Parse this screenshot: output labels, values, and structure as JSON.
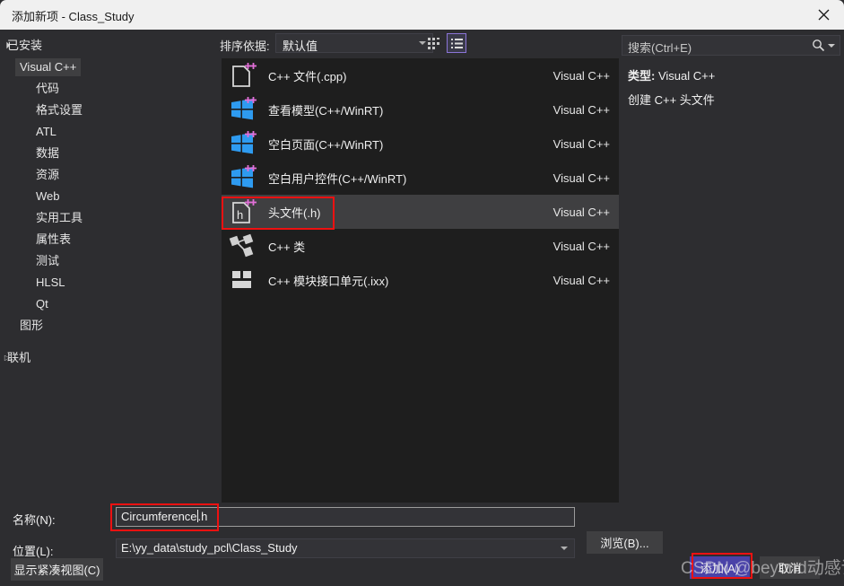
{
  "window": {
    "title": "添加新项 - Class_Study",
    "close_icon": "close-icon"
  },
  "sidebar": {
    "items": [
      {
        "label": "已安装",
        "level": 0,
        "arrow": "▲",
        "selected": false
      },
      {
        "label": "Visual C++",
        "level": 1,
        "arrow": "▲",
        "selected": true
      },
      {
        "label": "代码",
        "level": 2,
        "arrow": "",
        "selected": false
      },
      {
        "label": "格式设置",
        "level": 2,
        "arrow": "",
        "selected": false
      },
      {
        "label": "ATL",
        "level": 2,
        "arrow": "",
        "selected": false
      },
      {
        "label": "数据",
        "level": 2,
        "arrow": "",
        "selected": false
      },
      {
        "label": "资源",
        "level": 2,
        "arrow": "",
        "selected": false
      },
      {
        "label": "Web",
        "level": 2,
        "arrow": "",
        "selected": false
      },
      {
        "label": "实用工具",
        "level": 2,
        "arrow": "",
        "selected": false
      },
      {
        "label": "属性表",
        "level": 2,
        "arrow": "",
        "selected": false
      },
      {
        "label": "测试",
        "level": 2,
        "arrow": "",
        "selected": false
      },
      {
        "label": "HLSL",
        "level": 2,
        "arrow": "",
        "selected": false
      },
      {
        "label": "Qt",
        "level": 2,
        "arrow": "",
        "selected": false
      },
      {
        "label": "图形",
        "level": 1,
        "arrow": "",
        "selected": false
      },
      {
        "label": "联机",
        "level": 0,
        "arrow": "▶",
        "selected": false
      }
    ]
  },
  "toolbar": {
    "sort_label": "排序依据:",
    "sort_value": "默认值",
    "grid_view_icon": "grid-view-icon",
    "list_view_icon": "list-view-icon"
  },
  "templates": {
    "items": [
      {
        "title": "C++ 文件(.cpp)",
        "origin": "Visual C++",
        "icon": "cpp-file-icon",
        "selected": false
      },
      {
        "title": "查看模型(C++/WinRT)",
        "origin": "Visual C++",
        "icon": "winrt-view-model-icon",
        "selected": false
      },
      {
        "title": "空白页面(C++/WinRT)",
        "origin": "Visual C++",
        "icon": "winrt-blank-page-icon",
        "selected": false
      },
      {
        "title": "空白用户控件(C++/WinRT)",
        "origin": "Visual C++",
        "icon": "winrt-user-control-icon",
        "selected": false
      },
      {
        "title": "头文件(.h)",
        "origin": "Visual C++",
        "icon": "header-file-icon",
        "selected": true
      },
      {
        "title": "C++ 类",
        "origin": "Visual C++",
        "icon": "cpp-class-icon",
        "selected": false
      },
      {
        "title": "C++ 模块接口单元(.ixx)",
        "origin": "Visual C++",
        "icon": "cpp-module-icon",
        "selected": false
      }
    ]
  },
  "search": {
    "placeholder": "搜索(Ctrl+E)",
    "icon": "search-icon"
  },
  "details": {
    "type_label": "类型:",
    "type_value": "Visual C++",
    "description": "创建 C++ 头文件"
  },
  "bottom": {
    "name_label": "名称(N):",
    "name_value_before_caret": "Circumference",
    "name_value_after_caret": ".h",
    "location_label": "位置(L):",
    "location_value": "E:\\yy_data\\study_pcl\\Class_Study",
    "browse_button": "浏览(B)...",
    "compact_view_button": "显示紧凑视图(C)",
    "add_button": "添加(A)",
    "cancel_button": "取消"
  },
  "overlay": {
    "watermark": "CSDN @beyond动感语"
  },
  "colors": {
    "dialog_bg": "#2d2d30",
    "list_bg": "#1e1e1e",
    "titlebar_bg": "#f0f0f0",
    "selection_bg": "#3f3f41",
    "accent_purple": "#4a42a8",
    "annotation_red": "#ee1111"
  }
}
